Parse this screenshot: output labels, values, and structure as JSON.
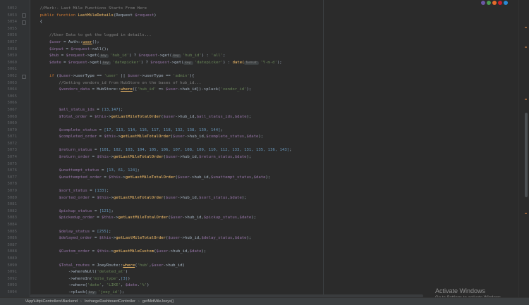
{
  "gutter": {
    "line_numbers": [
      "5052",
      "5053",
      "5054",
      "5055",
      "5056",
      "5057",
      "5058",
      "5059",
      "5060",
      "5061",
      "5062",
      "5063",
      "5064",
      "5065",
      "5066",
      "5067",
      "5068",
      "5069",
      "5070",
      "5071",
      "5072",
      "5073",
      "5074",
      "5075",
      "5076",
      "5077",
      "5078",
      "5079",
      "5080",
      "5081",
      "5082",
      "5083",
      "5084",
      "5085",
      "5086",
      "5087",
      "5088",
      "5089",
      "5090",
      "5091",
      "5092",
      "5093",
      "5094"
    ]
  },
  "code": {
    "comment_mark": "//Mark:- Last Mile Functions Starts From Here",
    "kw_public": "public",
    "kw_function": "function",
    "fn_name": "LastMileDetails",
    "sig_rest": "(Request ",
    "param_request": "$request",
    "brace_open": "{",
    "comment_user": "//User Data to get the logged in details...",
    "var_user": "$user",
    "auth_call": " = Auth::",
    "auth_user": "user",
    "var_input": "$input",
    "var_request": "$request",
    "all_call": "->all();",
    "var_hub": "$hub",
    "var_date": "$date",
    "get_call": "->get(",
    "hint_key": "key:",
    "hint_format": "format:",
    "str_hub_id": "'hub_id'",
    "str_all": "'all'",
    "str_datepicker": "'datepicker'",
    "str_ymd": "'Y-m-d'",
    "date_fn": "date(",
    "kw_if": "if",
    "usertype": "->userType == ",
    "str_user": "'user'",
    "str_admin": "'admin'",
    "comment_getting": "//Getting vendors_id from HubStore on the bases of hub_id...",
    "var_vendors_data": "$vendors_data",
    "hubstore_where": " = HubStore::",
    "where_fn": "where",
    "hub_id_ref": "->hub_id])->pluck(",
    "str_vendor_id": "'vendor_id'",
    "var_all_status_ids": "$all_status_ids",
    "nums_all_status": "[13,147]",
    "var_total_order": "$Total_order",
    "var_this": "$this",
    "fn_total": "getLastMileTotalOrder",
    "fn_custom": "getLastMileCustom",
    "var_complete_status": "$complete_status",
    "nums_complete": "[17, 113, 114, 116, 117, 118, 132, 138, 139, 144]",
    "var_completed_order": "$completed_order",
    "var_return_status": "$return_status",
    "nums_return": "[101, 102, 103, 104, 105, 106, 107, 108, 109, 110, 112, 133, 131, 135, 136, 143]",
    "var_return_order": "$return_order",
    "var_unattempt_status": "$unattempt_status",
    "nums_unattempt": "[13, 61, 124]",
    "var_unattempted_order": "$unattempted_order",
    "var_sort_status": "$sort_status",
    "nums_sort": "[133]",
    "var_sorted_order": "$sorted_order",
    "var_pickup_status": "$pickup_status",
    "nums_pickup": "[121]",
    "var_pickedup_order": "$pickedup_order",
    "var_delay_status": "$delay_status",
    "nums_delay": "[255]",
    "var_delayed_order": "$delayed_order",
    "var_custom_order": "$Custom_order",
    "var_total_routes": "$Total_routes",
    "joeyroute_where": " = JoeyRoute::",
    "str_hub": "'hub'",
    "wherenull": "->whereNull(",
    "str_deleted_at": "'deleted_at'",
    "wherein": "->whereIn(",
    "str_mile_type": "'mile_type'",
    "nums_three": "[3]",
    "where_date": "->where(",
    "str_date": "'date'",
    "str_like": "'LIKE'",
    "str_pct": "'%'",
    "pluck": "->pluck(",
    "str_joey_id": "'joey_id'"
  },
  "breadcrumb": [
    "\\App\\Http\\Controllers\\Backend",
    "InchargeDashboardController",
    "getMidMileJoeys()"
  ],
  "breadcrumb_separator": "›",
  "watermark": {
    "title": "Activate Windows",
    "subtitle": "Go to Settings to activate Windows."
  },
  "browser_icons": [
    "intellij-icon",
    "chrome-icon",
    "firefox-icon",
    "opera-icon",
    "edge-icon"
  ],
  "colors": {
    "background": "#2b2b2b",
    "keyword": "#cc7832",
    "variable": "#9876aa",
    "function": "#ffc66d",
    "string": "#6a8759",
    "number": "#6897bb",
    "comment": "#808080"
  }
}
